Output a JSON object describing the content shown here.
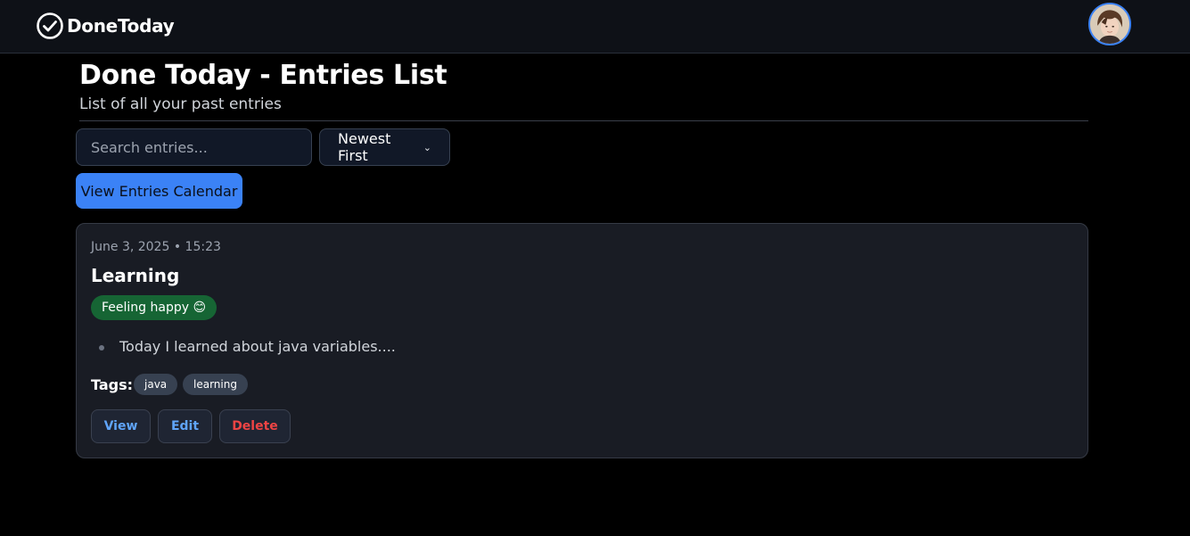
{
  "app": {
    "brand_name": "DoneToday",
    "brand_icon": "check-circle-icon",
    "accent_color": "#3b82f6"
  },
  "header": {
    "title": "Done Today - Entries List",
    "subtitle": "List of all your past entries"
  },
  "controls": {
    "search_placeholder": "Search entries...",
    "search_value": "",
    "sort_selected": "Newest First",
    "calendar_button_label": "View Entries Calendar"
  },
  "entries": [
    {
      "date": "June 3, 2025 • 15:23",
      "title": "Learning",
      "mood": "Feeling happy 😊",
      "mood_color": "#166534",
      "text": "Today I learned about java variables....",
      "tags_label": "Tags:",
      "tags": [
        "java",
        "learning"
      ],
      "actions": {
        "view": "View",
        "edit": "Edit",
        "delete": "Delete"
      }
    }
  ]
}
